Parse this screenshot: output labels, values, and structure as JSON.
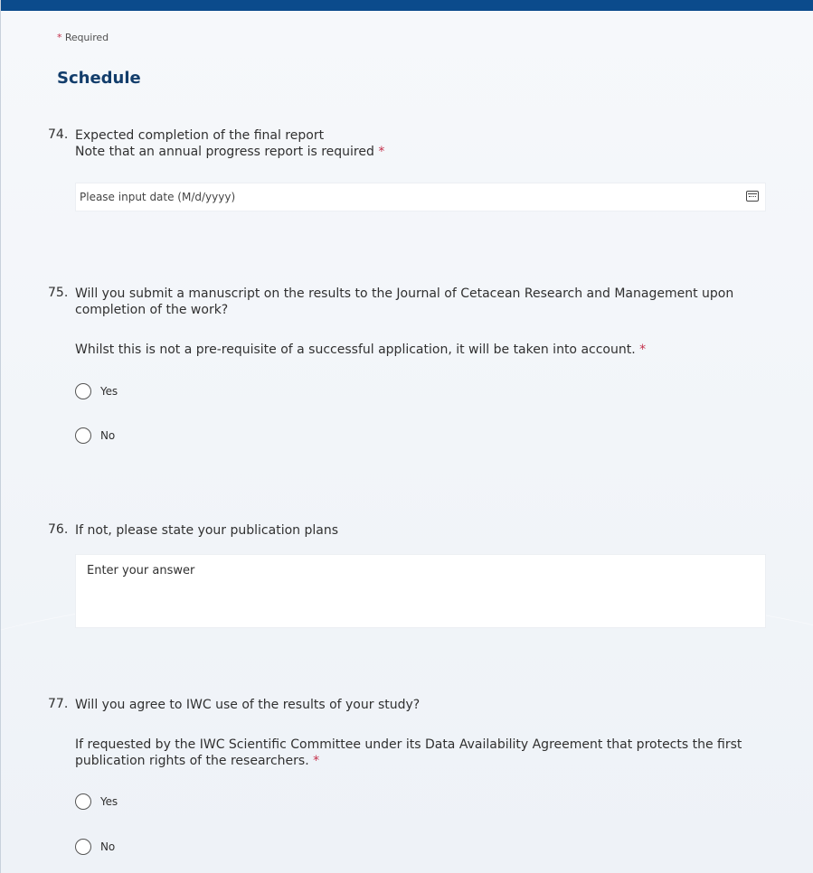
{
  "header": {
    "required_note": "Required",
    "section_title": "Schedule"
  },
  "questions": [
    {
      "number": "74.",
      "text": "Expected completion of the final report",
      "subtext": "Note that an annual progress report is required",
      "required": true,
      "input": {
        "type": "date",
        "placeholder": "Please input date (M/d/yyyy)",
        "icon": "calendar-icon"
      }
    },
    {
      "number": "75.",
      "text": "Will you submit a manuscript on the results to the Journal of Cetacean Research and Management upon completion of the work?",
      "subtext": "Whilst this is not a pre-requisite of a successful application, it will be taken into account.",
      "required": true,
      "options": [
        "Yes",
        "No"
      ]
    },
    {
      "number": "76.",
      "text": "If not, please state your publication plans",
      "input": {
        "type": "textarea",
        "placeholder": "Enter your answer"
      }
    },
    {
      "number": "77.",
      "text": "Will you agree to IWC use of the results of your study?",
      "subtext": "If requested by the IWC Scientific Committee under its Data Availability Agreement that protects the first publication rights of the researchers.",
      "required": true,
      "options": [
        "Yes",
        "No"
      ]
    }
  ],
  "colors": {
    "top_bar": "#0b4b8c",
    "section_title": "#123d6b",
    "required_asterisk": "#c4314b",
    "background": "#f6f8fb"
  }
}
